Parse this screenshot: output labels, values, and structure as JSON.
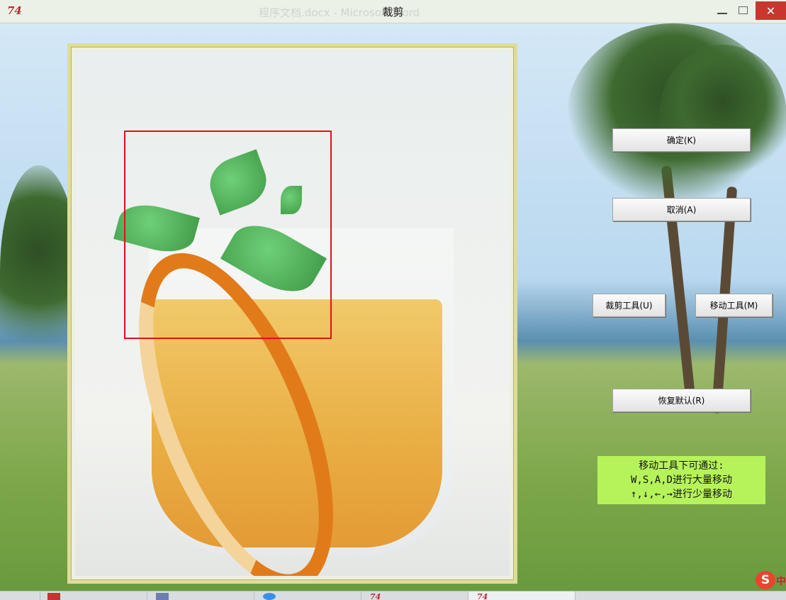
{
  "window": {
    "app_icon": "74",
    "title": "裁剪",
    "background_title": "程序文档.docx - Microsoft Word"
  },
  "buttons": {
    "ok": "确定(K)",
    "cancel": "取消(A)",
    "crop_tool": "裁剪工具(U)",
    "move_tool": "移动工具(M)",
    "reset": "恢复默认(R)"
  },
  "hint": {
    "line1": "移动工具下可通过:",
    "line2": "W,S,A,D进行大量移动",
    "line3": "↑,↓,←,→进行少量移动"
  },
  "taskbar": {
    "app_icon": "74"
  },
  "ime": {
    "icon": "S",
    "lang": "中"
  },
  "colors": {
    "hint_bg": "#b6f35a",
    "crop_rect": "#e0101a",
    "close_button": "#c7372f"
  }
}
